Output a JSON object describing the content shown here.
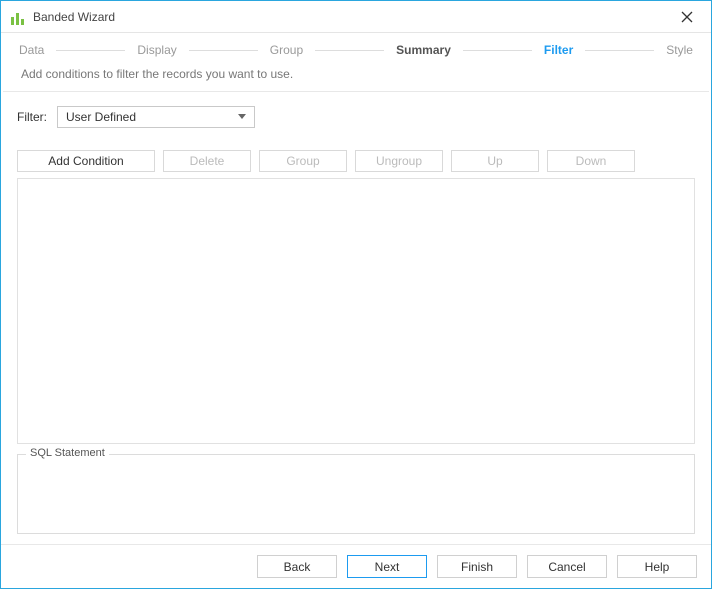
{
  "window": {
    "title": "Banded Wizard"
  },
  "steps": {
    "data": "Data",
    "display": "Display",
    "group": "Group",
    "summary": "Summary",
    "filter": "Filter",
    "style": "Style"
  },
  "subheader": "Add conditions to filter the records you want to use.",
  "filter": {
    "label": "Filter:",
    "selected": "User Defined"
  },
  "toolbar": {
    "add_condition": "Add Condition",
    "delete": "Delete",
    "group": "Group",
    "ungroup": "Ungroup",
    "up": "Up",
    "down": "Down"
  },
  "sql": {
    "legend": "SQL Statement"
  },
  "footer": {
    "back": "Back",
    "next": "Next",
    "finish": "Finish",
    "cancel": "Cancel",
    "help": "Help"
  }
}
